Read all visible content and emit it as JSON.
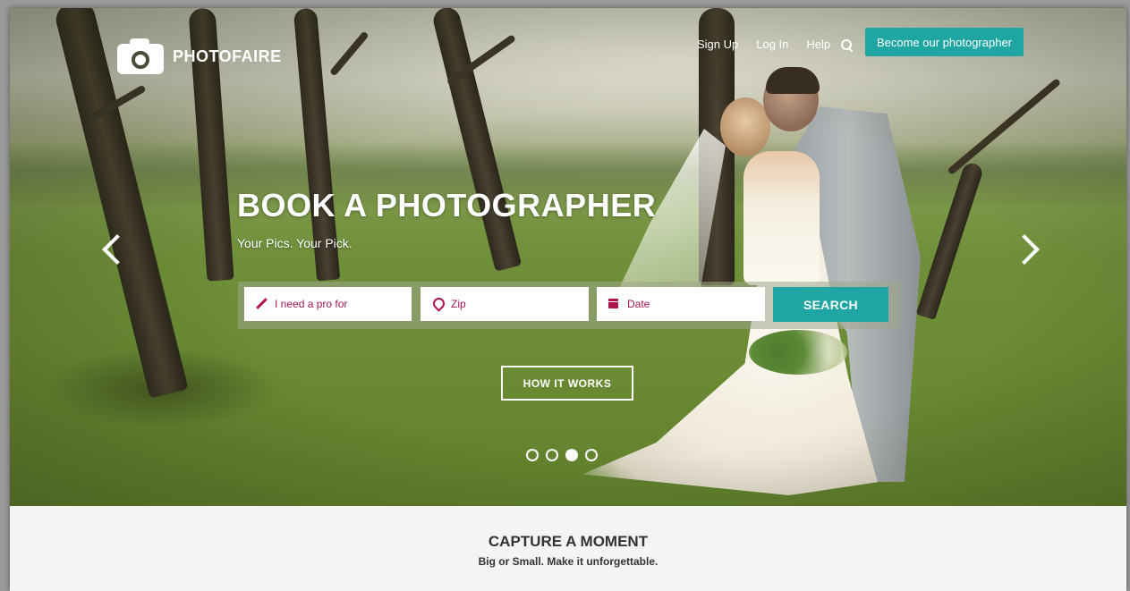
{
  "brand": {
    "name": "PHOTOFAIRE",
    "logo_icon": "camera-icon"
  },
  "nav": {
    "sign_up": "Sign Up",
    "log_in": "Log In",
    "help": "Help",
    "search_icon": "search-icon",
    "become_photographer": "Become our photographer"
  },
  "hero": {
    "title": "BOOK A PHOTOGRAPHER",
    "subtitle": "Your Pics.  Your Pick."
  },
  "search": {
    "service_placeholder": "I need a pro for",
    "zip_placeholder": "Zip",
    "date_placeholder": "Date",
    "button_label": "SEARCH"
  },
  "how_it_works": {
    "label": "HOW IT WORKS"
  },
  "carousel": {
    "slide_count": 4,
    "active_index": 2
  },
  "section": {
    "title": "CAPTURE A MOMENT",
    "subtitle": "Big or Small. Make it unforgettable."
  },
  "colors": {
    "accent": "#1fa5a2",
    "field_text": "#a5174f"
  }
}
